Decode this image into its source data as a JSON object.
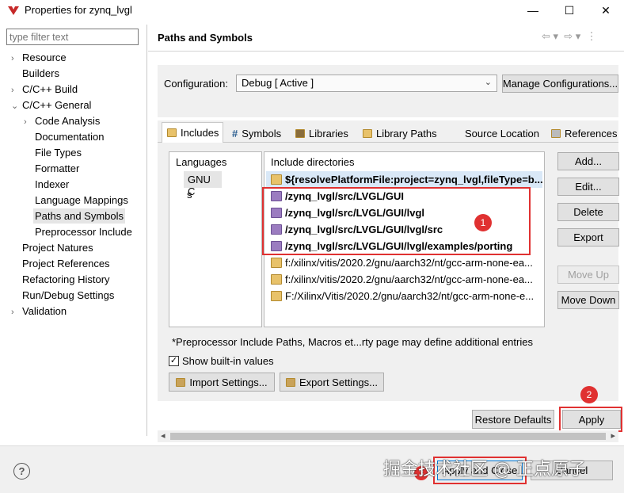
{
  "window": {
    "title": "Properties for zynq_lvgl"
  },
  "filter": {
    "placeholder": "type filter text"
  },
  "tree": [
    {
      "label": "Resource",
      "caret": "›",
      "indent": 0
    },
    {
      "label": "Builders",
      "caret": "",
      "indent": 0
    },
    {
      "label": "C/C++ Build",
      "caret": "›",
      "indent": 0
    },
    {
      "label": "C/C++ General",
      "caret": "⌄",
      "indent": 0
    },
    {
      "label": "Code Analysis",
      "caret": "›",
      "indent": 1
    },
    {
      "label": "Documentation",
      "caret": "",
      "indent": 1
    },
    {
      "label": "File Types",
      "caret": "",
      "indent": 1
    },
    {
      "label": "Formatter",
      "caret": "",
      "indent": 1
    },
    {
      "label": "Indexer",
      "caret": "",
      "indent": 1
    },
    {
      "label": "Language Mappings",
      "caret": "",
      "indent": 1
    },
    {
      "label": "Paths and Symbols",
      "caret": "",
      "indent": 1,
      "selected": true
    },
    {
      "label": "Preprocessor Include",
      "caret": "",
      "indent": 1
    },
    {
      "label": "Project Natures",
      "caret": "",
      "indent": 0
    },
    {
      "label": "Project References",
      "caret": "",
      "indent": 0
    },
    {
      "label": "Refactoring History",
      "caret": "",
      "indent": 0
    },
    {
      "label": "Run/Debug Settings",
      "caret": "",
      "indent": 0
    },
    {
      "label": "Validation",
      "caret": "›",
      "indent": 0
    }
  ],
  "panel": {
    "title": "Paths and Symbols"
  },
  "config": {
    "label": "Configuration:",
    "value": "Debug  [ Active ]",
    "manage_button": "Manage Configurations..."
  },
  "tabs": [
    "Includes",
    "Symbols",
    "Libraries",
    "Library Paths",
    "Source Location",
    "References"
  ],
  "languages": {
    "header": "Languages",
    "items": [
      "GNU C",
      "s"
    ]
  },
  "includes": {
    "header": "Include directories",
    "rows": [
      {
        "text": "${resolvePlatformFile:project=zynq_lvgl,fileType=b...",
        "bold": true,
        "icon": "folder-icon"
      },
      {
        "text": "/zynq_lvgl/src/LVGL/GUI",
        "bold": true,
        "icon": "project-folder-icon"
      },
      {
        "text": "/zynq_lvgl/src/LVGL/GUI/lvgl",
        "bold": true,
        "icon": "project-folder-icon"
      },
      {
        "text": "/zynq_lvgl/src/LVGL/GUI/lvgl/src",
        "bold": true,
        "icon": "project-folder-icon"
      },
      {
        "text": "/zynq_lvgl/src/LVGL/GUI/lvgl/examples/porting",
        "bold": true,
        "icon": "project-folder-icon"
      },
      {
        "text": "f:/xilinx/vitis/2020.2/gnu/aarch32/nt/gcc-arm-none-ea...",
        "bold": false,
        "icon": "folder-icon"
      },
      {
        "text": "f:/xilinx/vitis/2020.2/gnu/aarch32/nt/gcc-arm-none-ea...",
        "bold": false,
        "icon": "folder-icon"
      },
      {
        "text": "F:/Xilinx/Vitis/2020.2/gnu/aarch32/nt/gcc-arm-none-e...",
        "bold": false,
        "icon": "folder-icon"
      }
    ]
  },
  "side_buttons": {
    "add": "Add...",
    "edit": "Edit...",
    "delete": "Delete",
    "export": "Export",
    "move_up": "Move Up",
    "move_down": "Move Down"
  },
  "note": "*Preprocessor Include Paths, Macros et...rty page may define additional entries",
  "show_builtin": {
    "label": "Show built-in values",
    "checked": true
  },
  "import_button": "Import Settings...",
  "export_button": "Export Settings...",
  "restore_button": "Restore Defaults",
  "apply_button": "Apply",
  "apply_close_button": "Apply and Close",
  "cancel_button": "Cancel",
  "annotations": [
    "1",
    "2",
    "3"
  ],
  "watermark": "掘金技术社区 @ 正点原子",
  "colors": {
    "highlight": "#e03131",
    "selection": "#e5e5e5"
  }
}
